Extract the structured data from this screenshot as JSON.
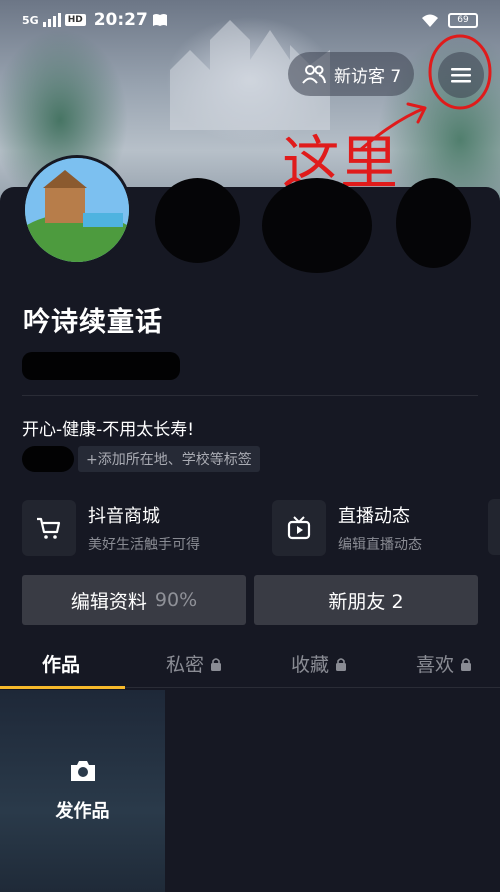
{
  "status_bar": {
    "signal": "5G",
    "hd": "HD",
    "time": "20:27",
    "battery": "69"
  },
  "header": {
    "visitors_label": "新访客 7"
  },
  "annotation": {
    "handwritten_text": "这里"
  },
  "profile": {
    "nickname": "吟诗续童话",
    "bio": "开心-健康-不用太长寿!",
    "add_tag_label": "+添加所在地、学校等标签"
  },
  "services": [
    {
      "title": "抖音商城",
      "subtitle": "美好生活触手可得",
      "icon": "cart-icon"
    },
    {
      "title": "直播动态",
      "subtitle": "编辑直播动态",
      "icon": "tv-icon"
    }
  ],
  "actions": {
    "edit_profile_label": "编辑资料",
    "edit_profile_percent": "90%",
    "new_friends_label": "新朋友 2"
  },
  "tabs": [
    {
      "label": "作品",
      "locked": false,
      "active": true
    },
    {
      "label": "私密",
      "locked": true,
      "active": false
    },
    {
      "label": "收藏",
      "locked": true,
      "active": false
    },
    {
      "label": "喜欢",
      "locked": true,
      "active": false
    }
  ],
  "post_tile": {
    "label": "发作品",
    "icon": "camera-icon"
  },
  "colors": {
    "background": "#161823",
    "accent": "#f7b92b",
    "annotation_red": "#e01b1b"
  }
}
